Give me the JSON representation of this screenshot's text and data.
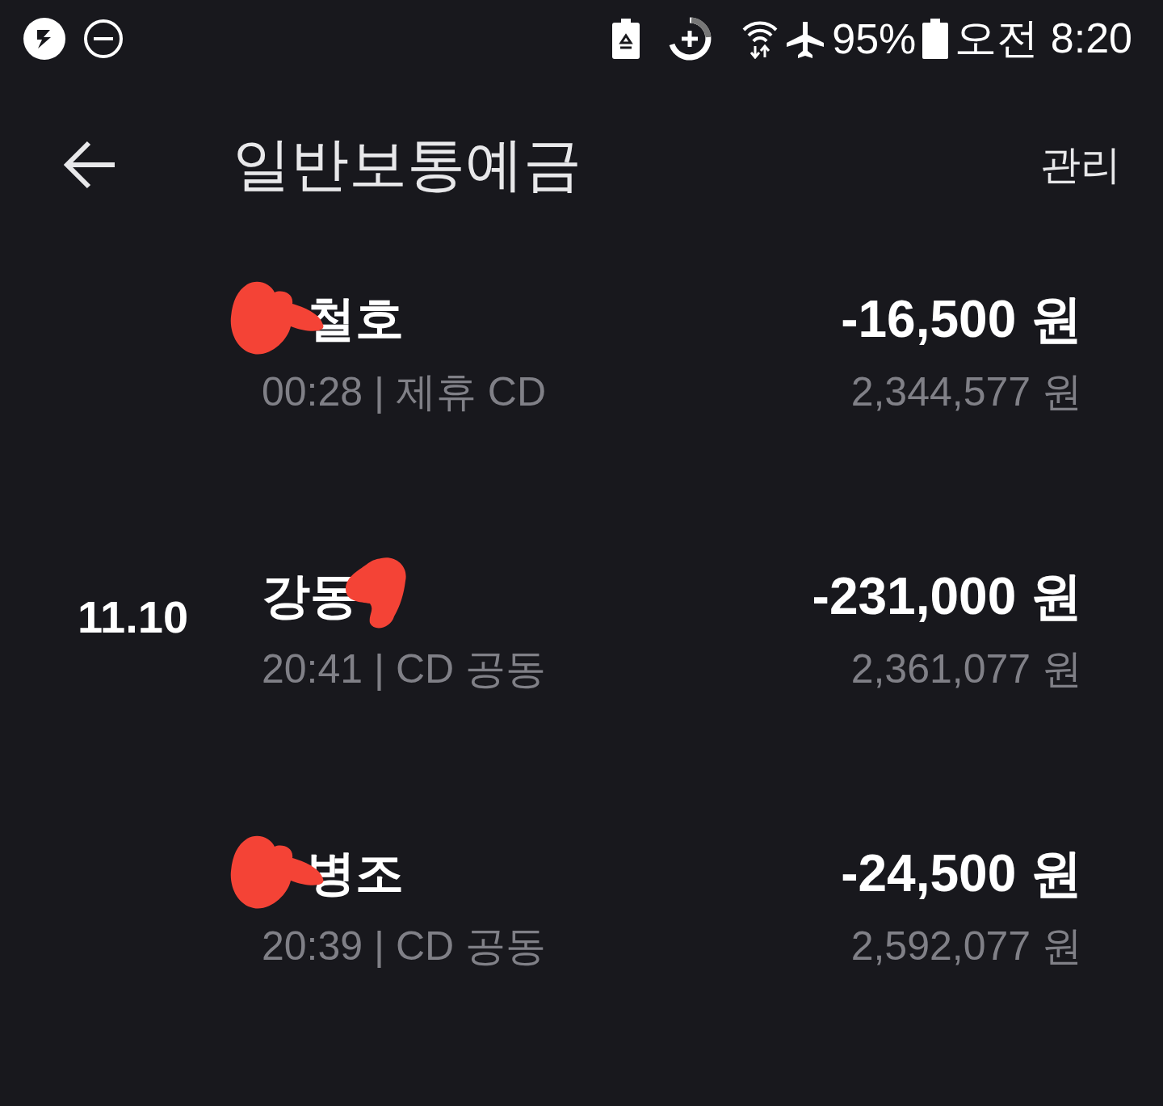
{
  "status_bar": {
    "battery_percent": "95%",
    "time": "오전 8:20"
  },
  "header": {
    "title": "일반보통예금",
    "action": "관리"
  },
  "transactions": [
    {
      "name": "철호",
      "kind": "redacted-start",
      "detail": "00:28 | 제휴 CD",
      "amount": "-16,500 원",
      "balance": "2,344,577 원"
    },
    {
      "date": "11.10",
      "name": "강동",
      "kind": "redacted-end",
      "detail": "20:41 | CD 공동",
      "amount": "-231,000 원",
      "balance": "2,361,077 원"
    },
    {
      "name": "병조",
      "kind": "redacted-start",
      "detail": "20:39 | CD 공동",
      "amount": "-24,500 원",
      "balance": "2,592,077 원"
    }
  ]
}
